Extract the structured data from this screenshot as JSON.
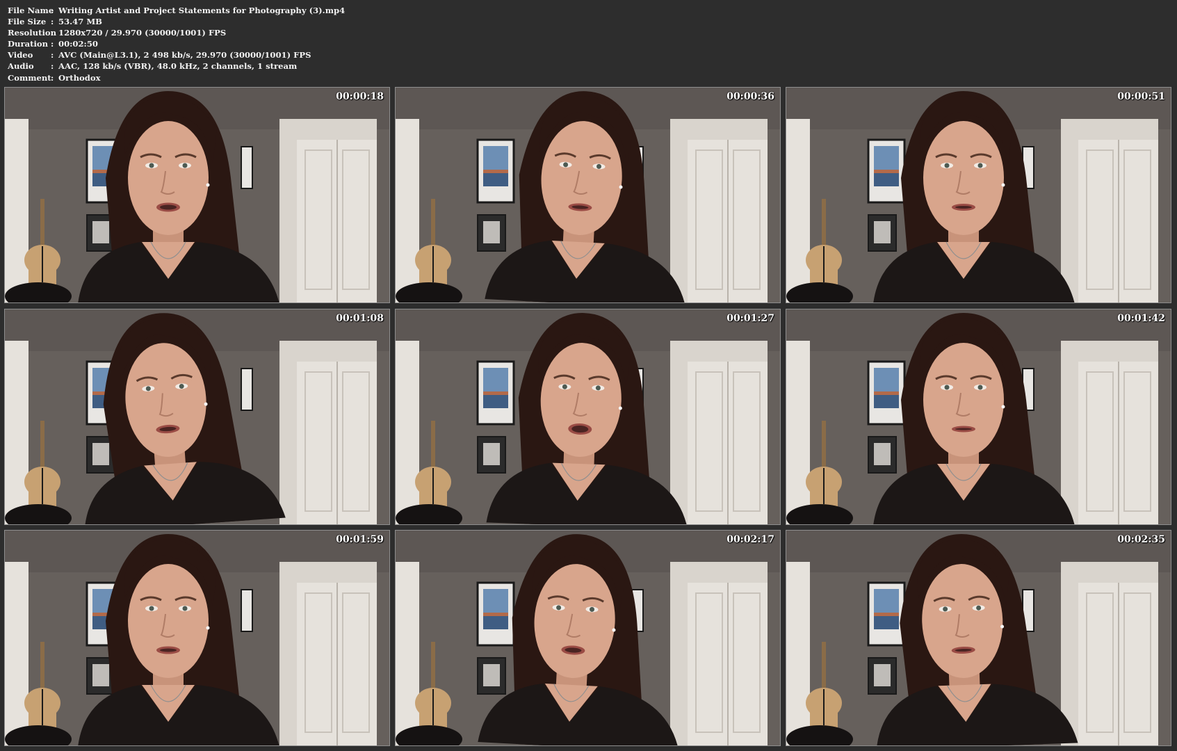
{
  "info": [
    {
      "label": "File Name",
      "value": "Writing Artist and Project Statements for Photography (3).mp4"
    },
    {
      "label": "File Size",
      "value": "53.47 MB"
    },
    {
      "label": "Resolution",
      "value": "1280x720 / 29.970 (30000/1001) FPS"
    },
    {
      "label": "Duration",
      "value": "00:02:50"
    },
    {
      "label": "Video",
      "value": "AVC (Main@L3.1), 2 498 kb/s, 29.970 (30000/1001) FPS"
    },
    {
      "label": "Audio",
      "value": "AAC, 128 kb/s (VBR), 48.0 kHz, 2 channels, 1 stream"
    },
    {
      "label": "Comment",
      "value": "Orthodox"
    }
  ],
  "separator": ":",
  "thumbnails": [
    {
      "timestamp": "00:00:18"
    },
    {
      "timestamp": "00:00:36"
    },
    {
      "timestamp": "00:00:51"
    },
    {
      "timestamp": "00:01:08"
    },
    {
      "timestamp": "00:01:27"
    },
    {
      "timestamp": "00:01:42"
    },
    {
      "timestamp": "00:01:59"
    },
    {
      "timestamp": "00:02:17"
    },
    {
      "timestamp": "00:02:35"
    }
  ],
  "colors": {
    "background": "#2d2d2d",
    "text": "#f2f2f2",
    "wall": "#66605c",
    "door": "#e6e2dc",
    "hair": "#2a1712",
    "skin": "#d8a58c",
    "shirt": "#1c1716",
    "dress_form": "#c7a172"
  }
}
